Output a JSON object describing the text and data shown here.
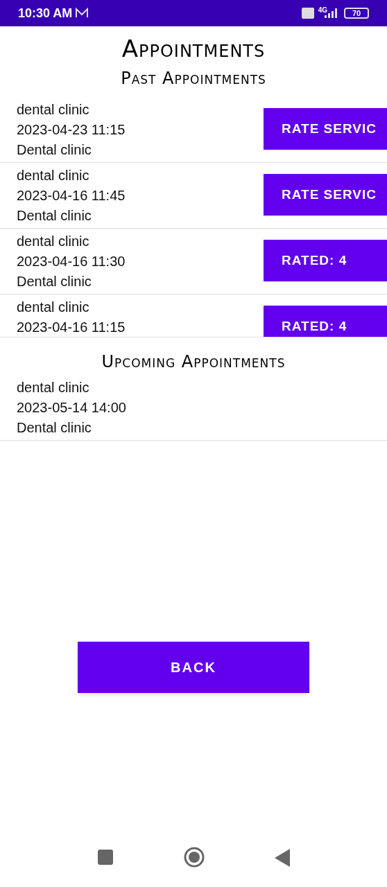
{
  "status_bar": {
    "time": "10:30 AM",
    "battery": "70",
    "network": "4G"
  },
  "title": "Appointments",
  "past": {
    "heading": "Past Appointments",
    "items": [
      {
        "name": "dental clinic",
        "datetime": "2023-04-23 11:15",
        "clinic": "Dental clinic",
        "button": "RATE SERVIC"
      },
      {
        "name": "dental clinic",
        "datetime": "2023-04-16 11:45",
        "clinic": "Dental clinic",
        "button": "RATE SERVIC"
      },
      {
        "name": "dental clinic",
        "datetime": "2023-04-16 11:30",
        "clinic": "Dental clinic",
        "button": "RATED: 4"
      },
      {
        "name": "dental clinic",
        "datetime": "2023-04-16 11:15",
        "button": "RATED: 4"
      }
    ]
  },
  "upcoming": {
    "heading": "Upcoming Appointments",
    "items": [
      {
        "name": "dental clinic",
        "datetime": "2023-05-14 14:00",
        "clinic": "Dental clinic"
      }
    ]
  },
  "back_button": "BACK"
}
